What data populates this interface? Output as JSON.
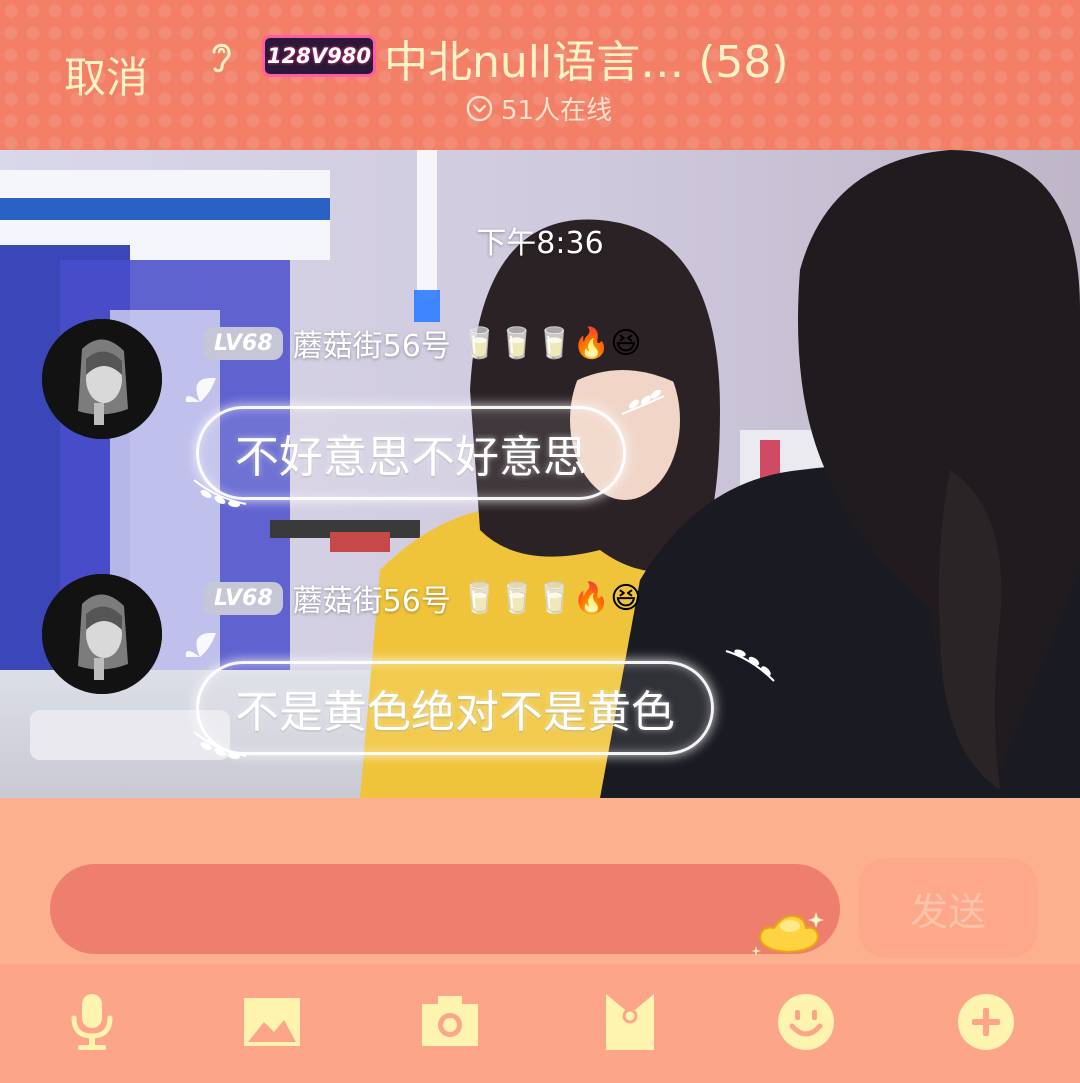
{
  "header": {
    "cancel_label": "取消",
    "logo_text": "128V980",
    "group_title": "中北null语言…  (58)",
    "online_text": "51人在线"
  },
  "chat": {
    "timestamp": "下午8:36",
    "messages": [
      {
        "level": "LV68",
        "sender": "蘑菇街56号",
        "emojis": "🥛🥛🥛🔥😆",
        "text": "不好意思不好意思"
      },
      {
        "level": "LV68",
        "sender": "蘑菇街56号",
        "emojis": "🥛🥛🥛🔥😆",
        "text": "不是黄色绝对不是黄色"
      }
    ]
  },
  "input": {
    "value": "",
    "placeholder": "",
    "send_label": "发送"
  },
  "toolbar": {
    "icons": [
      "microphone-icon",
      "image-icon",
      "camera-icon",
      "red-packet-icon",
      "emoji-icon",
      "plus-icon"
    ]
  },
  "colors": {
    "header_bg": "#f27f66",
    "accent_text": "#fff2c4",
    "input_bg": "#ee7e6d",
    "panel_bg": "#fcb08e",
    "toolbar_icon": "#fff3b0"
  }
}
